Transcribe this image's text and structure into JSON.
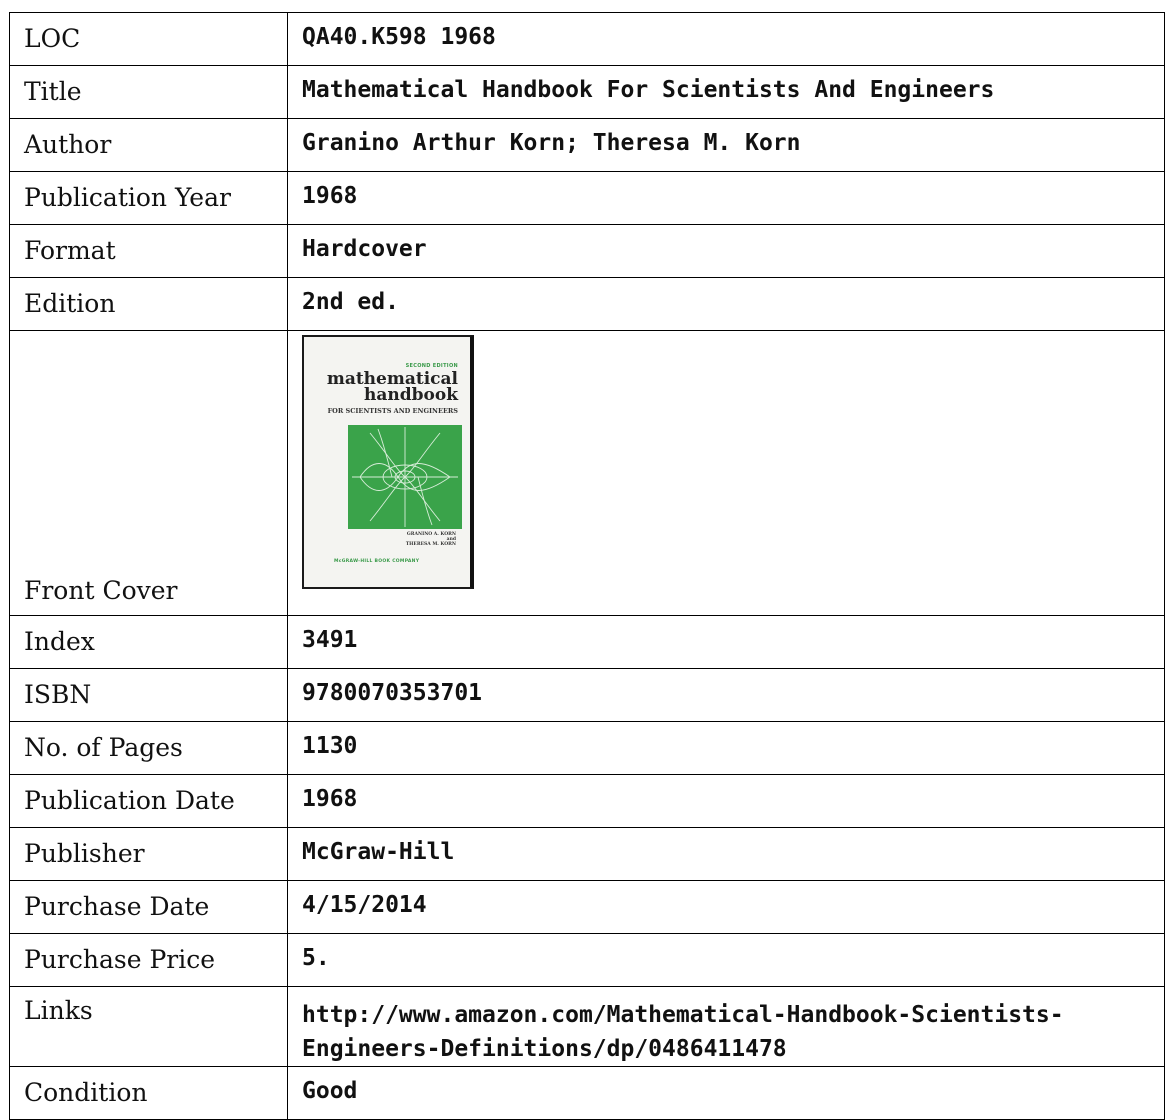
{
  "record": {
    "loc": {
      "label": "LOC",
      "value": "QA40.K598 1968"
    },
    "title": {
      "label": "Title",
      "value": "Mathematical Handbook For Scientists And Engineers"
    },
    "author": {
      "label": "Author",
      "value": "Granino Arthur Korn; Theresa M. Korn"
    },
    "publication_year": {
      "label": "Publication Year",
      "value": "1968"
    },
    "format": {
      "label": "Format",
      "value": "Hardcover"
    },
    "edition": {
      "label": "Edition",
      "value": "2nd ed."
    },
    "front_cover": {
      "label": "Front Cover",
      "cover_text": {
        "edition": "SECOND EDITION",
        "title_line1": "mathematical",
        "title_line2": "handbook",
        "subtitle": "FOR SCIENTISTS AND ENGINEERS",
        "author_line1": "GRANINO A. KORN",
        "author_line2": "and",
        "author_line3": "THERESA M. KORN",
        "publisher": "McGRAW-HILL BOOK COMPANY"
      },
      "colors": {
        "art_green": "#3aa34a",
        "cover_bg": "#f4f4f1"
      }
    },
    "index": {
      "label": "Index",
      "value": "3491"
    },
    "isbn": {
      "label": "ISBN",
      "value": "9780070353701"
    },
    "pages": {
      "label": "No. of Pages",
      "value": "1130"
    },
    "publication_date": {
      "label": "Publication Date",
      "value": "1968"
    },
    "publisher": {
      "label": "Publisher",
      "value": "McGraw-Hill"
    },
    "purchase_date": {
      "label": "Purchase Date",
      "value": "4/15/2014"
    },
    "purchase_price": {
      "label": "Purchase Price",
      "value": "5."
    },
    "links": {
      "label": "Links",
      "value_line1": "http://www.amazon.com/Mathematical-Handbook-Scientists-",
      "value_line2": "Engineers-Definitions/dp/0486411478"
    },
    "condition": {
      "label": "Condition",
      "value": "Good"
    }
  }
}
